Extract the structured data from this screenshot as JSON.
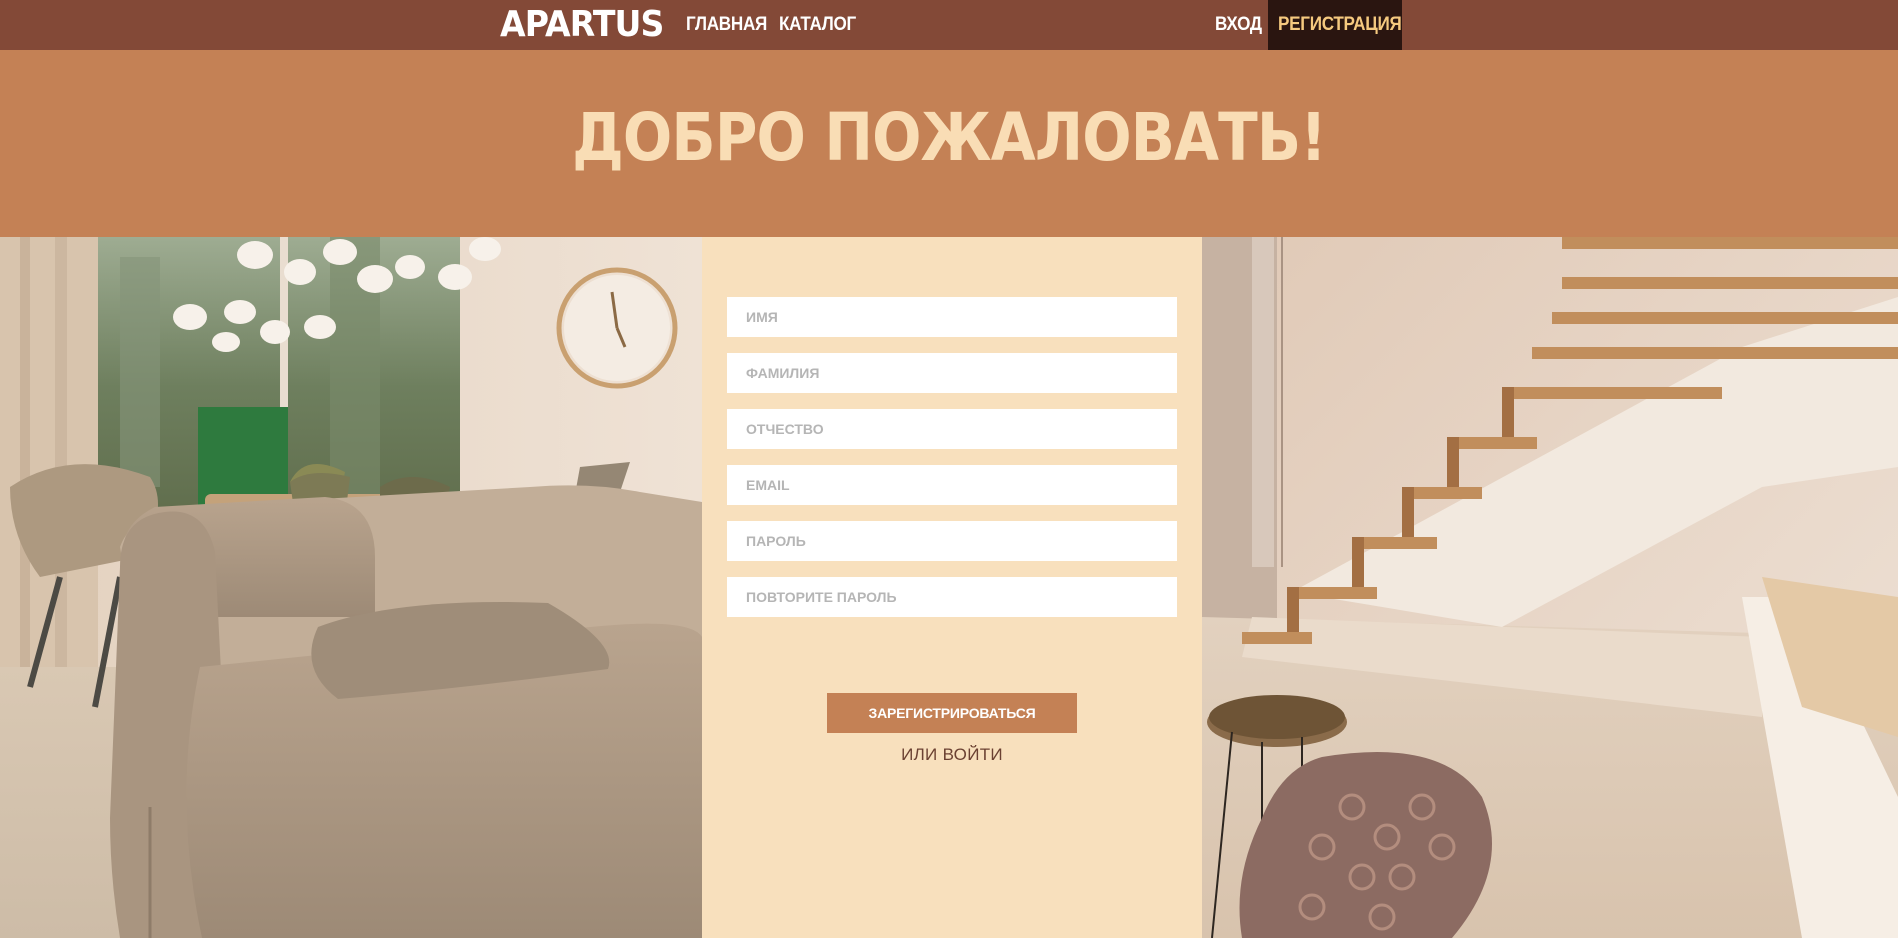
{
  "nav": {
    "logo": "APARTUS",
    "home": "ГЛАВНАЯ",
    "catalog": "КАТАЛОГ",
    "login": "ВХОД",
    "register": "РЕГИСТРАЦИЯ"
  },
  "hero": {
    "title": "ДОБРО ПОЖАЛОВАТЬ!"
  },
  "form": {
    "first_name_placeholder": "ИМЯ",
    "last_name_placeholder": "ФАМИЛИЯ",
    "patronymic_placeholder": "ОТЧЕСТВО",
    "email_placeholder": "EMAIL",
    "password_placeholder": "ПАРОЛЬ",
    "password_repeat_placeholder": "ПОВТОРИТЕ ПАРОЛЬ",
    "submit_label": "ЗАРЕГИСТРИРОВАТЬСЯ",
    "alt_login_label": "ИЛИ ВОЙТИ"
  },
  "colors": {
    "nav_bg": "#834937",
    "nav_active_bg": "#2a1510",
    "nav_active_text": "#f5c97f",
    "hero_bg": "#c48155",
    "hero_text": "#f9ddb5",
    "form_bg": "#f8e0bd",
    "button_bg": "#c48155"
  },
  "images": {
    "left_photo": "living-room-sofa-photo",
    "right_photo": "staircase-interior-photo"
  }
}
